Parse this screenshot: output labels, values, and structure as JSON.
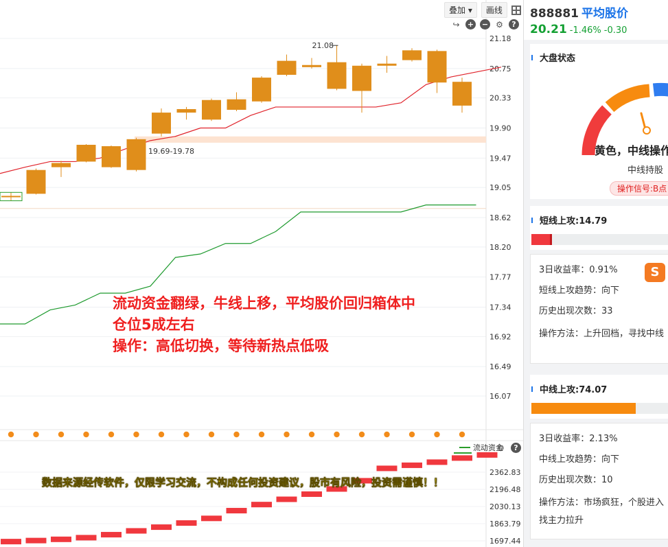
{
  "toolbar": {
    "overlay_label": "叠加",
    "draw_label": "画线"
  },
  "chart_data": [
    {
      "type": "candlestick",
      "title": "",
      "y_ticks": [
        "21.18",
        "20.75",
        "20.33",
        "19.90",
        "19.47",
        "19.05",
        "18.62",
        "18.20",
        "17.77",
        "17.34",
        "16.92",
        "16.49",
        "16.07"
      ],
      "ylim": [
        15.9,
        21.3
      ],
      "candles": [
        {
          "open": 18.92,
          "close": 18.93,
          "high": 18.98,
          "low": 18.86
        },
        {
          "open": 18.96,
          "close": 19.3,
          "high": 19.32,
          "low": 18.95
        },
        {
          "open": 19.34,
          "close": 19.4,
          "high": 19.43,
          "low": 19.2
        },
        {
          "open": 19.42,
          "close": 19.66,
          "high": 19.67,
          "low": 19.41
        },
        {
          "open": 19.34,
          "close": 19.64,
          "high": 19.65,
          "low": 19.33
        },
        {
          "open": 19.3,
          "close": 19.74,
          "high": 19.76,
          "low": 19.28
        },
        {
          "open": 19.82,
          "close": 20.12,
          "high": 20.18,
          "low": 19.78
        },
        {
          "open": 20.12,
          "close": 20.17,
          "high": 20.2,
          "low": 20.02
        },
        {
          "open": 20.02,
          "close": 20.3,
          "high": 20.32,
          "low": 20.0
        },
        {
          "open": 20.16,
          "close": 20.31,
          "high": 20.41,
          "low": 20.14
        },
        {
          "open": 20.28,
          "close": 20.62,
          "high": 20.64,
          "low": 20.26
        },
        {
          "open": 20.66,
          "close": 20.86,
          "high": 20.95,
          "low": 20.64
        },
        {
          "open": 20.77,
          "close": 20.8,
          "high": 20.9,
          "low": 20.75
        },
        {
          "open": 20.84,
          "close": 20.46,
          "high": 21.08,
          "low": 20.44
        },
        {
          "open": 20.79,
          "close": 20.43,
          "high": 20.82,
          "low": 20.12
        },
        {
          "open": 20.79,
          "close": 20.82,
          "high": 20.93,
          "low": 20.69
        },
        {
          "open": 20.87,
          "close": 21.01,
          "high": 21.04,
          "low": 20.85
        },
        {
          "open": 21.0,
          "close": 20.55,
          "high": 21.02,
          "low": 20.4
        },
        {
          "open": 20.56,
          "close": 20.22,
          "high": 20.62,
          "low": 20.12
        }
      ],
      "red_line": [
        19.25,
        19.34,
        19.42,
        19.42,
        19.47,
        19.6,
        19.72,
        19.78,
        19.9,
        19.9,
        20.08,
        20.2,
        20.2,
        20.2,
        20.2,
        20.2,
        20.26,
        20.52,
        20.63,
        20.7,
        20.77
      ],
      "green_line": [
        17.1,
        17.1,
        17.3,
        17.37,
        17.54,
        17.54,
        17.64,
        18.05,
        18.1,
        18.25,
        18.25,
        18.42,
        18.7,
        18.7,
        18.7,
        18.7,
        18.7,
        18.8,
        18.8,
        18.8
      ],
      "annotations": [
        {
          "text": "21.08",
          "x_index": 13,
          "value": 21.08
        },
        {
          "text": "19.69-19.78",
          "x_index": 5,
          "value": 19.69
        }
      ],
      "band": {
        "low": 19.69,
        "high": 19.78
      }
    },
    {
      "type": "bar",
      "title": "流动资金",
      "y_ticks": [
        "2362.83",
        "2196.48",
        "2030.13",
        "1863.79",
        "1697.44"
      ],
      "ylim": [
        1680,
        2480
      ],
      "values": [
        1690,
        1700,
        1712,
        1728,
        1757,
        1794,
        1830,
        1870,
        1915,
        1990,
        2049,
        2100,
        2150,
        2200,
        2280,
        2400,
        2430,
        2460,
        2500,
        2530
      ]
    }
  ],
  "signal_dots_count": 19,
  "note": {
    "line1": "流动资金翻绿，牛线上移，平均股价回归箱体中",
    "line2": "仓位5成左右",
    "line3": "操作：高低切换，等待新热点低吸"
  },
  "disclaimer": "数据来源经传软件，仅限学习交流，不构成任何投资建议，股市有风险，投资需谨慎！！",
  "flow_label": "流动资金",
  "panel": {
    "code": "888881",
    "name": "平均股价",
    "price": "20.21",
    "pct": "-1.46%",
    "change": "-0.30",
    "market_title": "大盘状态",
    "market_state": "黄色，中线操作",
    "market_sub": "中线持股",
    "market_signal": "操作信号:B点",
    "short": {
      "title": "短线上攻:14.79",
      "level_pct": 14.79,
      "return_rate": "3日收益率：0.91%",
      "trend": "短线上攻趋势：向下",
      "count": "历史出现次数：33",
      "method": "操作方法：上升回档，寻找中线"
    },
    "mid": {
      "title": "中线上攻:74.07",
      "level_pct": 74.07,
      "return_rate": "3日收益率：2.13%",
      "trend": "中线上攻趋势：向下",
      "count": "历史出现次数：10",
      "method": "操作方法：市场疯狂，个股进入",
      "method2": "找主力拉升"
    }
  },
  "colors": {
    "candle": "#e08e1b",
    "red_line": "#e0222a",
    "green_line": "#1e9a2e",
    "flow_bar": "#f0383e",
    "dot": "#f28c1a"
  }
}
